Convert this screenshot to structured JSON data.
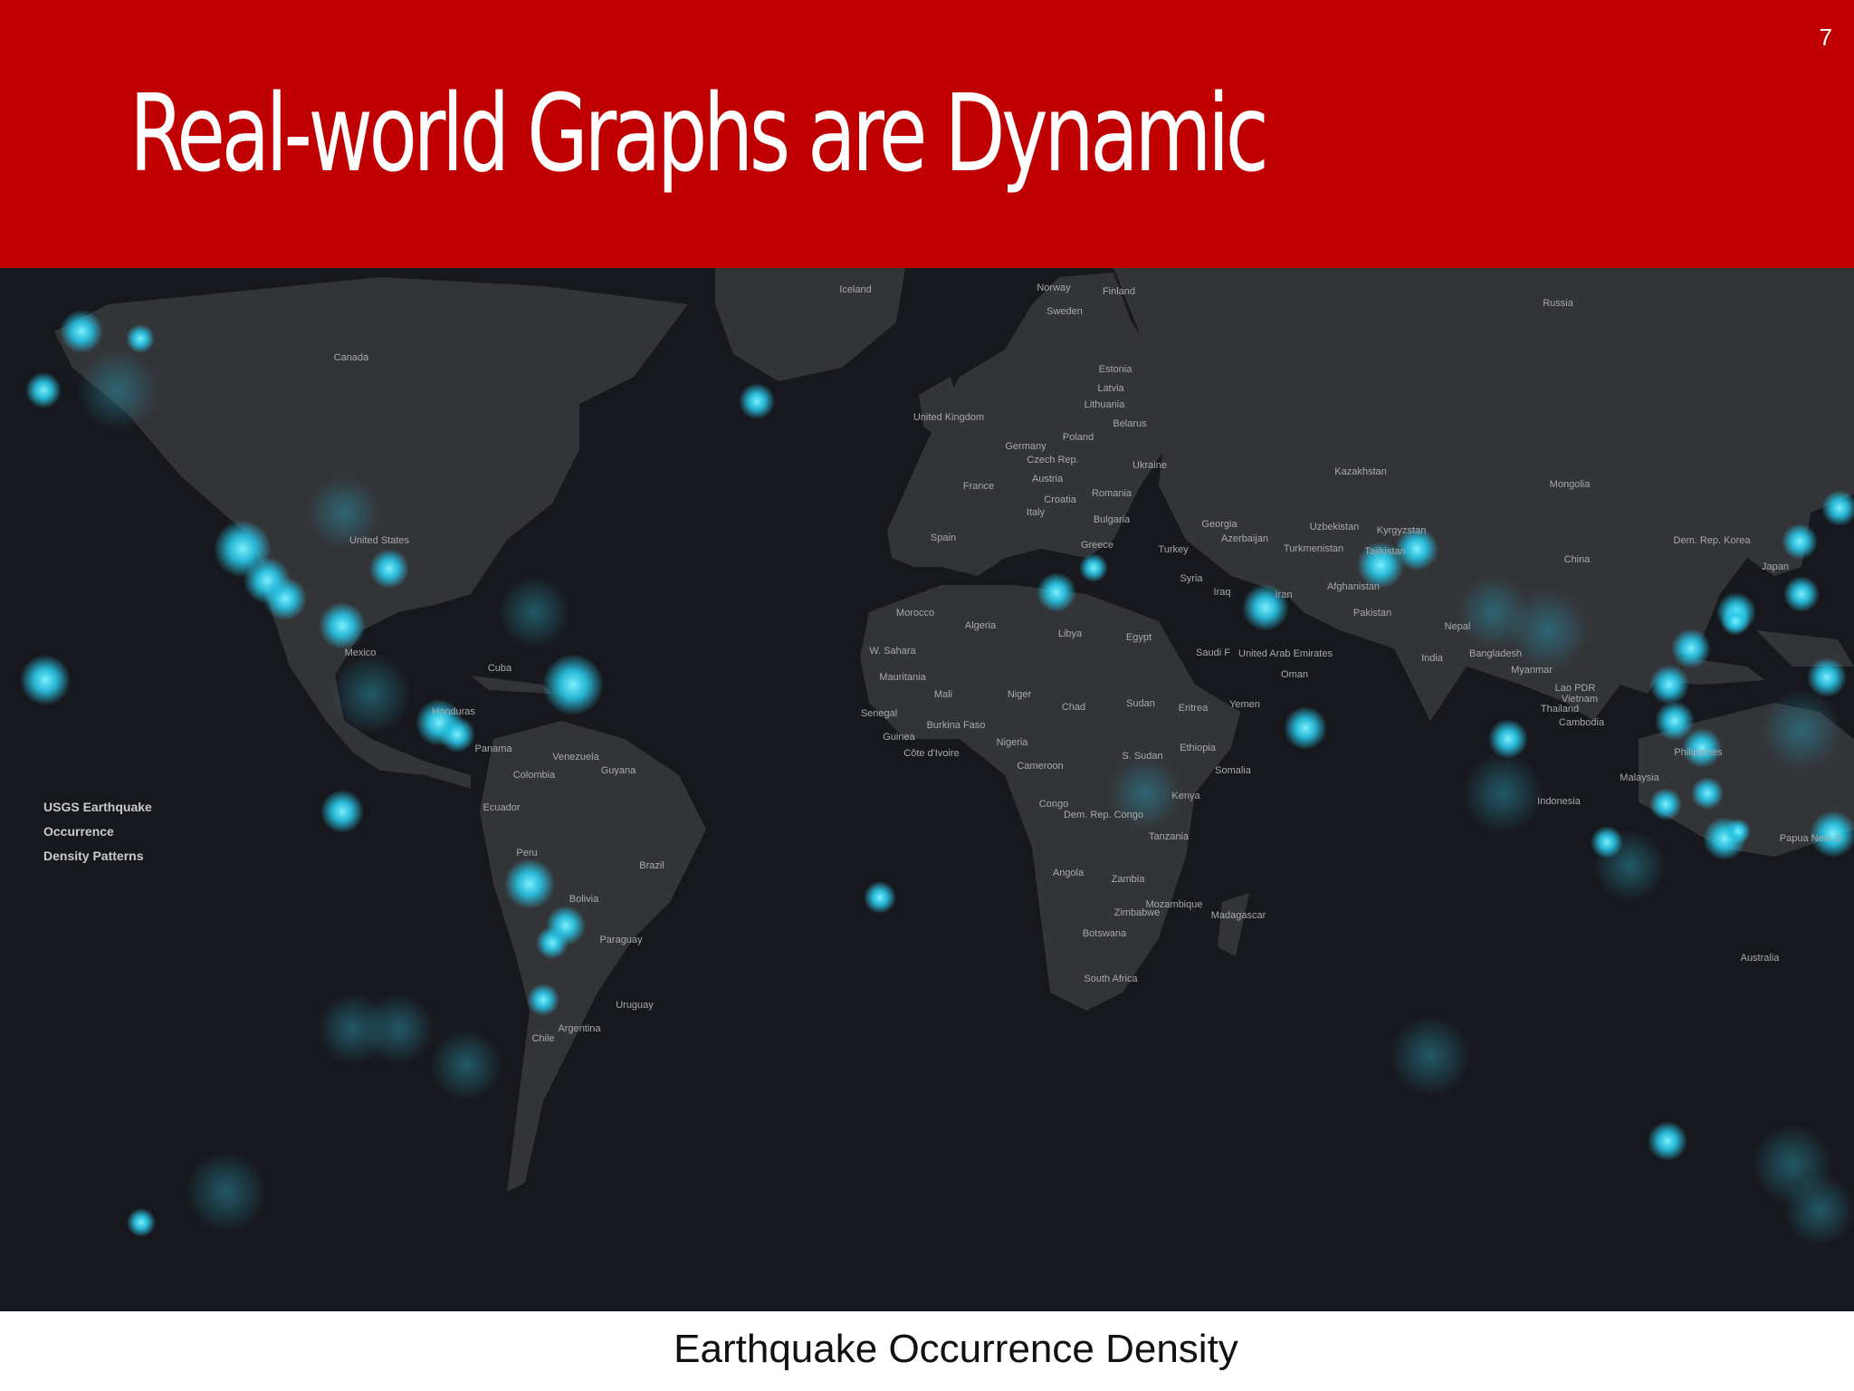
{
  "slide": {
    "title": "Real-world Graphs are Dynamic",
    "page_number": "7",
    "caption": "Earthquake Occurrence Density",
    "header_color": "#c00000"
  },
  "map": {
    "background_color": "#17181d",
    "land_color": "#333438",
    "hotspot_color": "#29c7e8",
    "legend": [
      "USGS Earthquake",
      "Occurrence",
      "Density Patterns"
    ],
    "labels": [
      "Iceland",
      "Norway",
      "Finland",
      "Sweden",
      "Russia",
      "Canada",
      "Estonia",
      "Latvia",
      "Lithuania",
      "Belarus",
      "United Kingdom",
      "Poland",
      "Germany",
      "Czech Rep.",
      "Ukraine",
      "Austria",
      "France",
      "Romania",
      "Croatia",
      "Kazakhstan",
      "Mongolia",
      "Italy",
      "Bulgaria",
      "Georgia",
      "Azerbaijan",
      "Uzbekistan",
      "Kyrgyzstan",
      "Turkmenistan",
      "Tajikistan",
      "United States",
      "Spain",
      "Greece",
      "Turkey",
      "China",
      "Dem. Rep. Korea",
      "Japan",
      "Syria",
      "Iraq",
      "Iran",
      "Afghanistan",
      "Morocco",
      "Algeria",
      "Libya",
      "Egypt",
      "Pakistan",
      "Nepal",
      "Mexico",
      "W. Sahara",
      "Saudi F",
      "United Arab Emirates",
      "India",
      "Bangladesh",
      "Cuba",
      "Mauritania",
      "Oman",
      "Myanmar",
      "Mali",
      "Niger",
      "Lao PDR",
      "Vietnam",
      "Thailand",
      "Honduras",
      "Senegal",
      "Burkina Faso",
      "Chad",
      "Sudan",
      "Eritrea",
      "Yemen",
      "Cambodia",
      "Guinea",
      "Panama",
      "Nigeria",
      "Côte d'Ivoire",
      "Venezuela",
      "Guyana",
      "S. Sudan",
      "Ethiopia",
      "Philippines",
      "Cameroon",
      "Somalia",
      "Colombia",
      "Malaysia",
      "Kenya",
      "Congo",
      "Dem. Rep. Congo",
      "Ecuador",
      "Indonesia",
      "Papua New G",
      "Tanzania",
      "Peru",
      "Brazil",
      "Angola",
      "Zambia",
      "Bolivia",
      "Mozambique",
      "Zimbabwe",
      "Madagascar",
      "Paraguay",
      "Botswana",
      "Australia",
      "South Africa",
      "Uruguay",
      "Argentina",
      "Chile"
    ]
  }
}
